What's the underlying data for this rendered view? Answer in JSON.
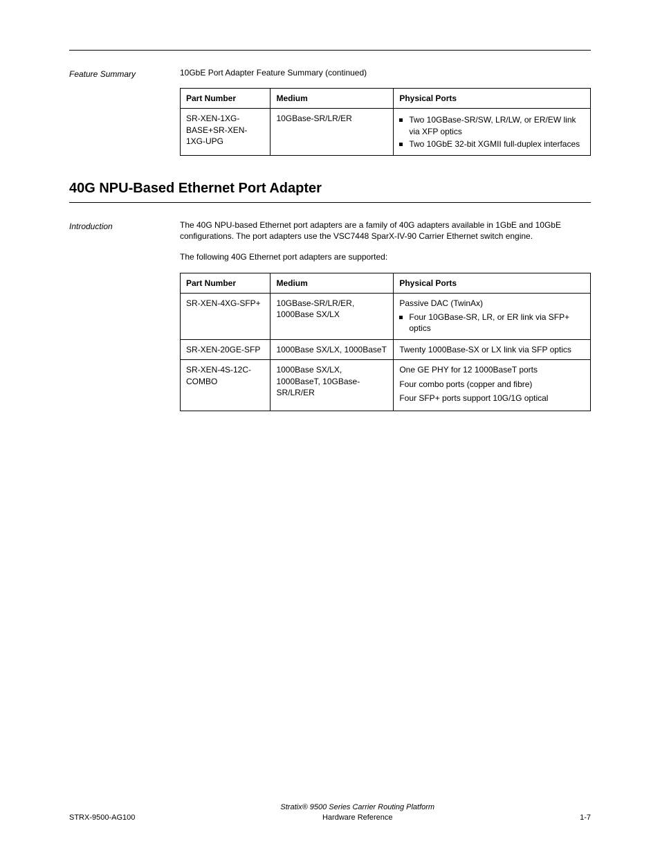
{
  "labels": {
    "feature_summary": "Feature Summary",
    "introduction": "Introduction"
  },
  "table_headers": {
    "part_number": "Part Number",
    "medium": "Medium",
    "physical_ports": "Physical Ports"
  },
  "section1": {
    "intro": "10GbE Port Adapter Feature Summary (continued)",
    "rows": [
      {
        "part": "SR-XEN-1XG-BASE+SR-XEN-1XG-UPG",
        "medium": "10GBase-SR/LR/ER",
        "phys": [
          "Two 10GBase-SR/SW, LR/LW, or ER/EW link via XFP optics",
          "Two 10GbE 32-bit XGMII full-duplex interfaces"
        ]
      }
    ]
  },
  "heading": "40G NPU-Based Ethernet Port Adapter",
  "section2": {
    "intro": "The 40G NPU-based Ethernet port adapters are a family of 40G adapters available in 1GbE and 10GbE configurations. The port adapters use the VSC7448 SparX-IV-90 Carrier Ethernet switch engine.",
    "table_intro": "The following 40G Ethernet port adapters are supported:",
    "rows": [
      {
        "part": "SR-XEN-4XG-SFP+",
        "medium": "10GBase-SR/LR/ER, 1000Base SX/LX",
        "phys_plain": "Passive DAC (TwinAx)",
        "phys_bullets": [
          "Four 10GBase-SR, LR, or ER link via SFP+ optics"
        ]
      },
      {
        "part": "SR-XEN-20GE-SFP",
        "medium": "1000Base SX/LX, 1000BaseT",
        "phys_plain": "Twenty 1000Base-SX or LX link via SFP optics"
      },
      {
        "part": "SR-XEN-4S-12C-COMBO",
        "medium": "1000Base SX/LX, 1000BaseT, 10GBase-SR/LR/ER",
        "phys_plain_lines": [
          "One GE PHY for 12 1000BaseT ports",
          "Four combo ports (copper and fibre)",
          "Four SFP+ ports support 10G/1G optical"
        ]
      }
    ]
  },
  "footer": {
    "left": "STRX-9500-AG100",
    "center_line1": "Stratix® 9500 Series Carrier Routing Platform",
    "center_line2": "Hardware Reference",
    "right": "1-7"
  }
}
